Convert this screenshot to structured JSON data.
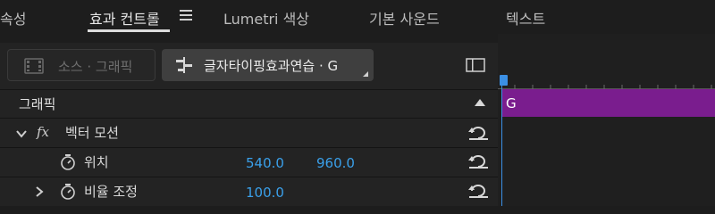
{
  "tabs": [
    {
      "label": "속성"
    },
    {
      "label": "효과 컨트롤"
    },
    {
      "label": "Lumetri 색상"
    },
    {
      "label": "기본 사운드"
    },
    {
      "label": "텍스트"
    }
  ],
  "toolbar": {
    "source_label": "소스 · 그래픽",
    "sequence_label": "글자타이핑효과연습 · G"
  },
  "effects": {
    "section_title": "그래픽",
    "fx_glyph": "fx",
    "vector_motion": "벡터 모션",
    "position": {
      "label": "위치",
      "x": "540.0",
      "y": "960.0"
    },
    "scale": {
      "label": "비율 조정",
      "value": "100.0"
    }
  },
  "timeline": {
    "clip_label": "G"
  },
  "colors": {
    "accent": "#3aa0ea",
    "clip": "#7a1d8e",
    "playhead": "#3b8fe4"
  }
}
